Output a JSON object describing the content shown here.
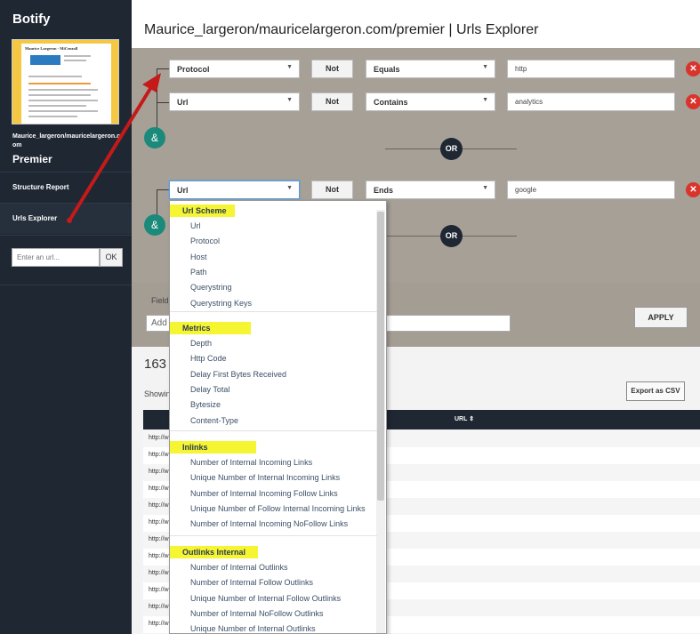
{
  "sidebar": {
    "brand": "Botify",
    "thumbnail_title": "Maurice Largeron - MiCenzoll",
    "site_name": "Maurice_largeron/mauricelargeron.com",
    "plan": "Premier",
    "nav": [
      {
        "label": "Structure Report"
      },
      {
        "label": "Urls Explorer"
      }
    ],
    "url_input_placeholder": "Enter an url...",
    "ok_label": "OK"
  },
  "header": {
    "title": "Maurice_largeron/mauricelargeron.com/premier | Urls Explorer"
  },
  "filters": {
    "not_label": "Not",
    "or_label": "OR",
    "and_label": "&",
    "rows": [
      {
        "field": "Protocol",
        "operator": "Equals",
        "value": "http"
      },
      {
        "field": "Url",
        "operator": "Contains",
        "value": "analytics"
      },
      {
        "field": "Url",
        "operator": "Ends",
        "value": "google"
      }
    ],
    "fields_label": "Fields",
    "fields_placeholder": "Add",
    "apply_label": "APPLY"
  },
  "results": {
    "count": "163",
    "showing": "Showin",
    "export_label": "Export as CSV",
    "column_header": "URL ⇕",
    "row_prefix": "http://w",
    "row_count": 12
  },
  "dropdown": {
    "groups": [
      {
        "name": "Url Scheme",
        "options": [
          "Url",
          "Protocol",
          "Host",
          "Path",
          "Querystring",
          "Querystring Keys"
        ]
      },
      {
        "name": "Metrics",
        "options": [
          "Depth",
          "Http Code",
          "Delay First Bytes Received",
          "Delay Total",
          "Bytesize",
          "Content-Type"
        ]
      },
      {
        "name": "Inlinks",
        "options": [
          "Number of Internal Incoming Links",
          "Unique Number of Internal Incoming Links",
          "Number of Internal Incoming Follow Links",
          "Unique Number of Follow Internal Incoming Links",
          "Number of Internal Incoming NoFollow Links"
        ]
      },
      {
        "name": "Outlinks Internal",
        "options": [
          "Number of Internal Outlinks",
          "Number of Internal Follow Outlinks",
          "Unique Number of Internal Follow Outlinks",
          "Number of Internal NoFollow Outlinks",
          "Unique Number of Internal Outlinks"
        ]
      }
    ]
  },
  "colors": {
    "sidebar_bg": "#1f2733",
    "filter_panel_bg": "#a7a097",
    "highlight": "#f5f532",
    "annotation_arrow": "#c41a1a",
    "delete_red": "#d9342b",
    "and_teal": "#1c8a7a"
  }
}
